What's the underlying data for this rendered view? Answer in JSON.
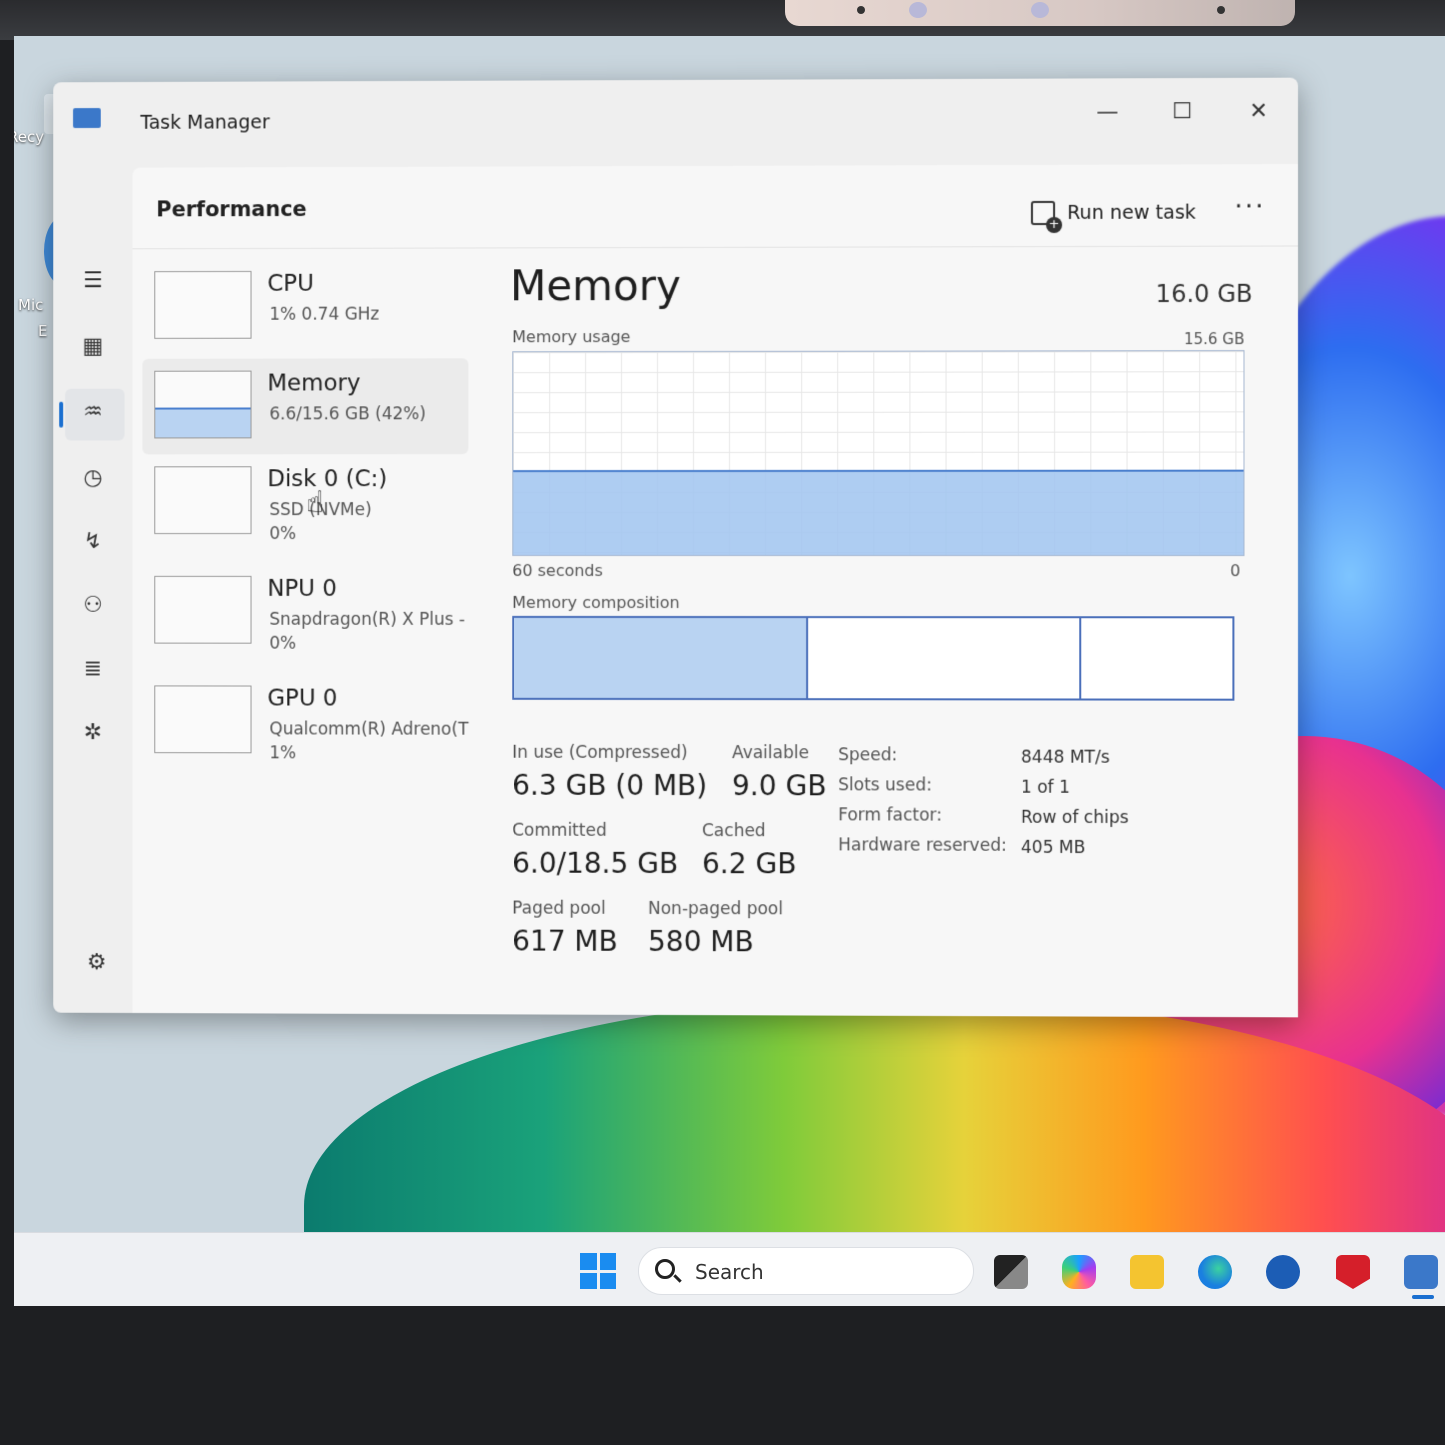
{
  "desktop": {
    "icon_labels": [
      "Recy",
      "Mic",
      "E"
    ]
  },
  "window": {
    "title": "Task Manager",
    "controls": {
      "minimize": "—",
      "maximize": "☐",
      "close": "✕"
    }
  },
  "nav": {
    "icons": [
      "hamburger-icon",
      "processes-icon",
      "performance-icon",
      "app-history-icon",
      "startup-apps-icon",
      "users-icon",
      "details-icon",
      "services-icon",
      "settings-icon"
    ],
    "selected": "performance-icon"
  },
  "header": {
    "title": "Performance",
    "run_task_label": "Run new task",
    "more_label": "···"
  },
  "devices": [
    {
      "name": "CPU",
      "sub": "1%  0.74 GHz",
      "sub2": ""
    },
    {
      "name": "Memory",
      "sub": "6.6/15.6 GB (42%)",
      "sub2": "",
      "usage_fraction": 0.42
    },
    {
      "name": "Disk 0 (C:)",
      "sub": "SSD (NVMe)",
      "sub2": "0%"
    },
    {
      "name": "NPU 0",
      "sub": "Snapdragon(R) X Plus -",
      "sub2": "0%"
    },
    {
      "name": "GPU 0",
      "sub": "Qualcomm(R) Adreno(T",
      "sub2": "1%"
    }
  ],
  "memory": {
    "title": "Memory",
    "total": "16.0 GB",
    "usage_label": "Memory usage",
    "usage_max": "15.6 GB",
    "usage_fraction": 0.42,
    "time_label": "60 seconds",
    "time_end": "0",
    "composition_label": "Memory composition",
    "composition_fractions": [
      0.41,
      0.38,
      0.21
    ],
    "stats": {
      "in_use_label": "In use (Compressed)",
      "in_use_value": "6.3 GB (0 MB)",
      "available_label": "Available",
      "available_value": "9.0 GB",
      "committed_label": "Committed",
      "committed_value": "6.0/18.5 GB",
      "cached_label": "Cached",
      "cached_value": "6.2 GB",
      "paged_label": "Paged pool",
      "paged_value": "617 MB",
      "nonpaged_label": "Non-paged pool",
      "nonpaged_value": "580 MB"
    },
    "specs": [
      {
        "k": "Speed:",
        "v": "8448 MT/s"
      },
      {
        "k": "Slots used:",
        "v": "1 of 1"
      },
      {
        "k": "Form factor:",
        "v": "Row of chips"
      },
      {
        "k": "Hardware reserved:",
        "v": "405 MB"
      }
    ]
  },
  "taskbar": {
    "search_label": "Search",
    "pinned": [
      "task-view-icon",
      "copilot-icon",
      "file-explorer-icon",
      "edge-icon",
      "dell-icon",
      "mcafee-icon",
      "task-manager-icon"
    ],
    "colors": {
      "accent": "#1a6fd0",
      "start": "#1a8cf0"
    }
  }
}
